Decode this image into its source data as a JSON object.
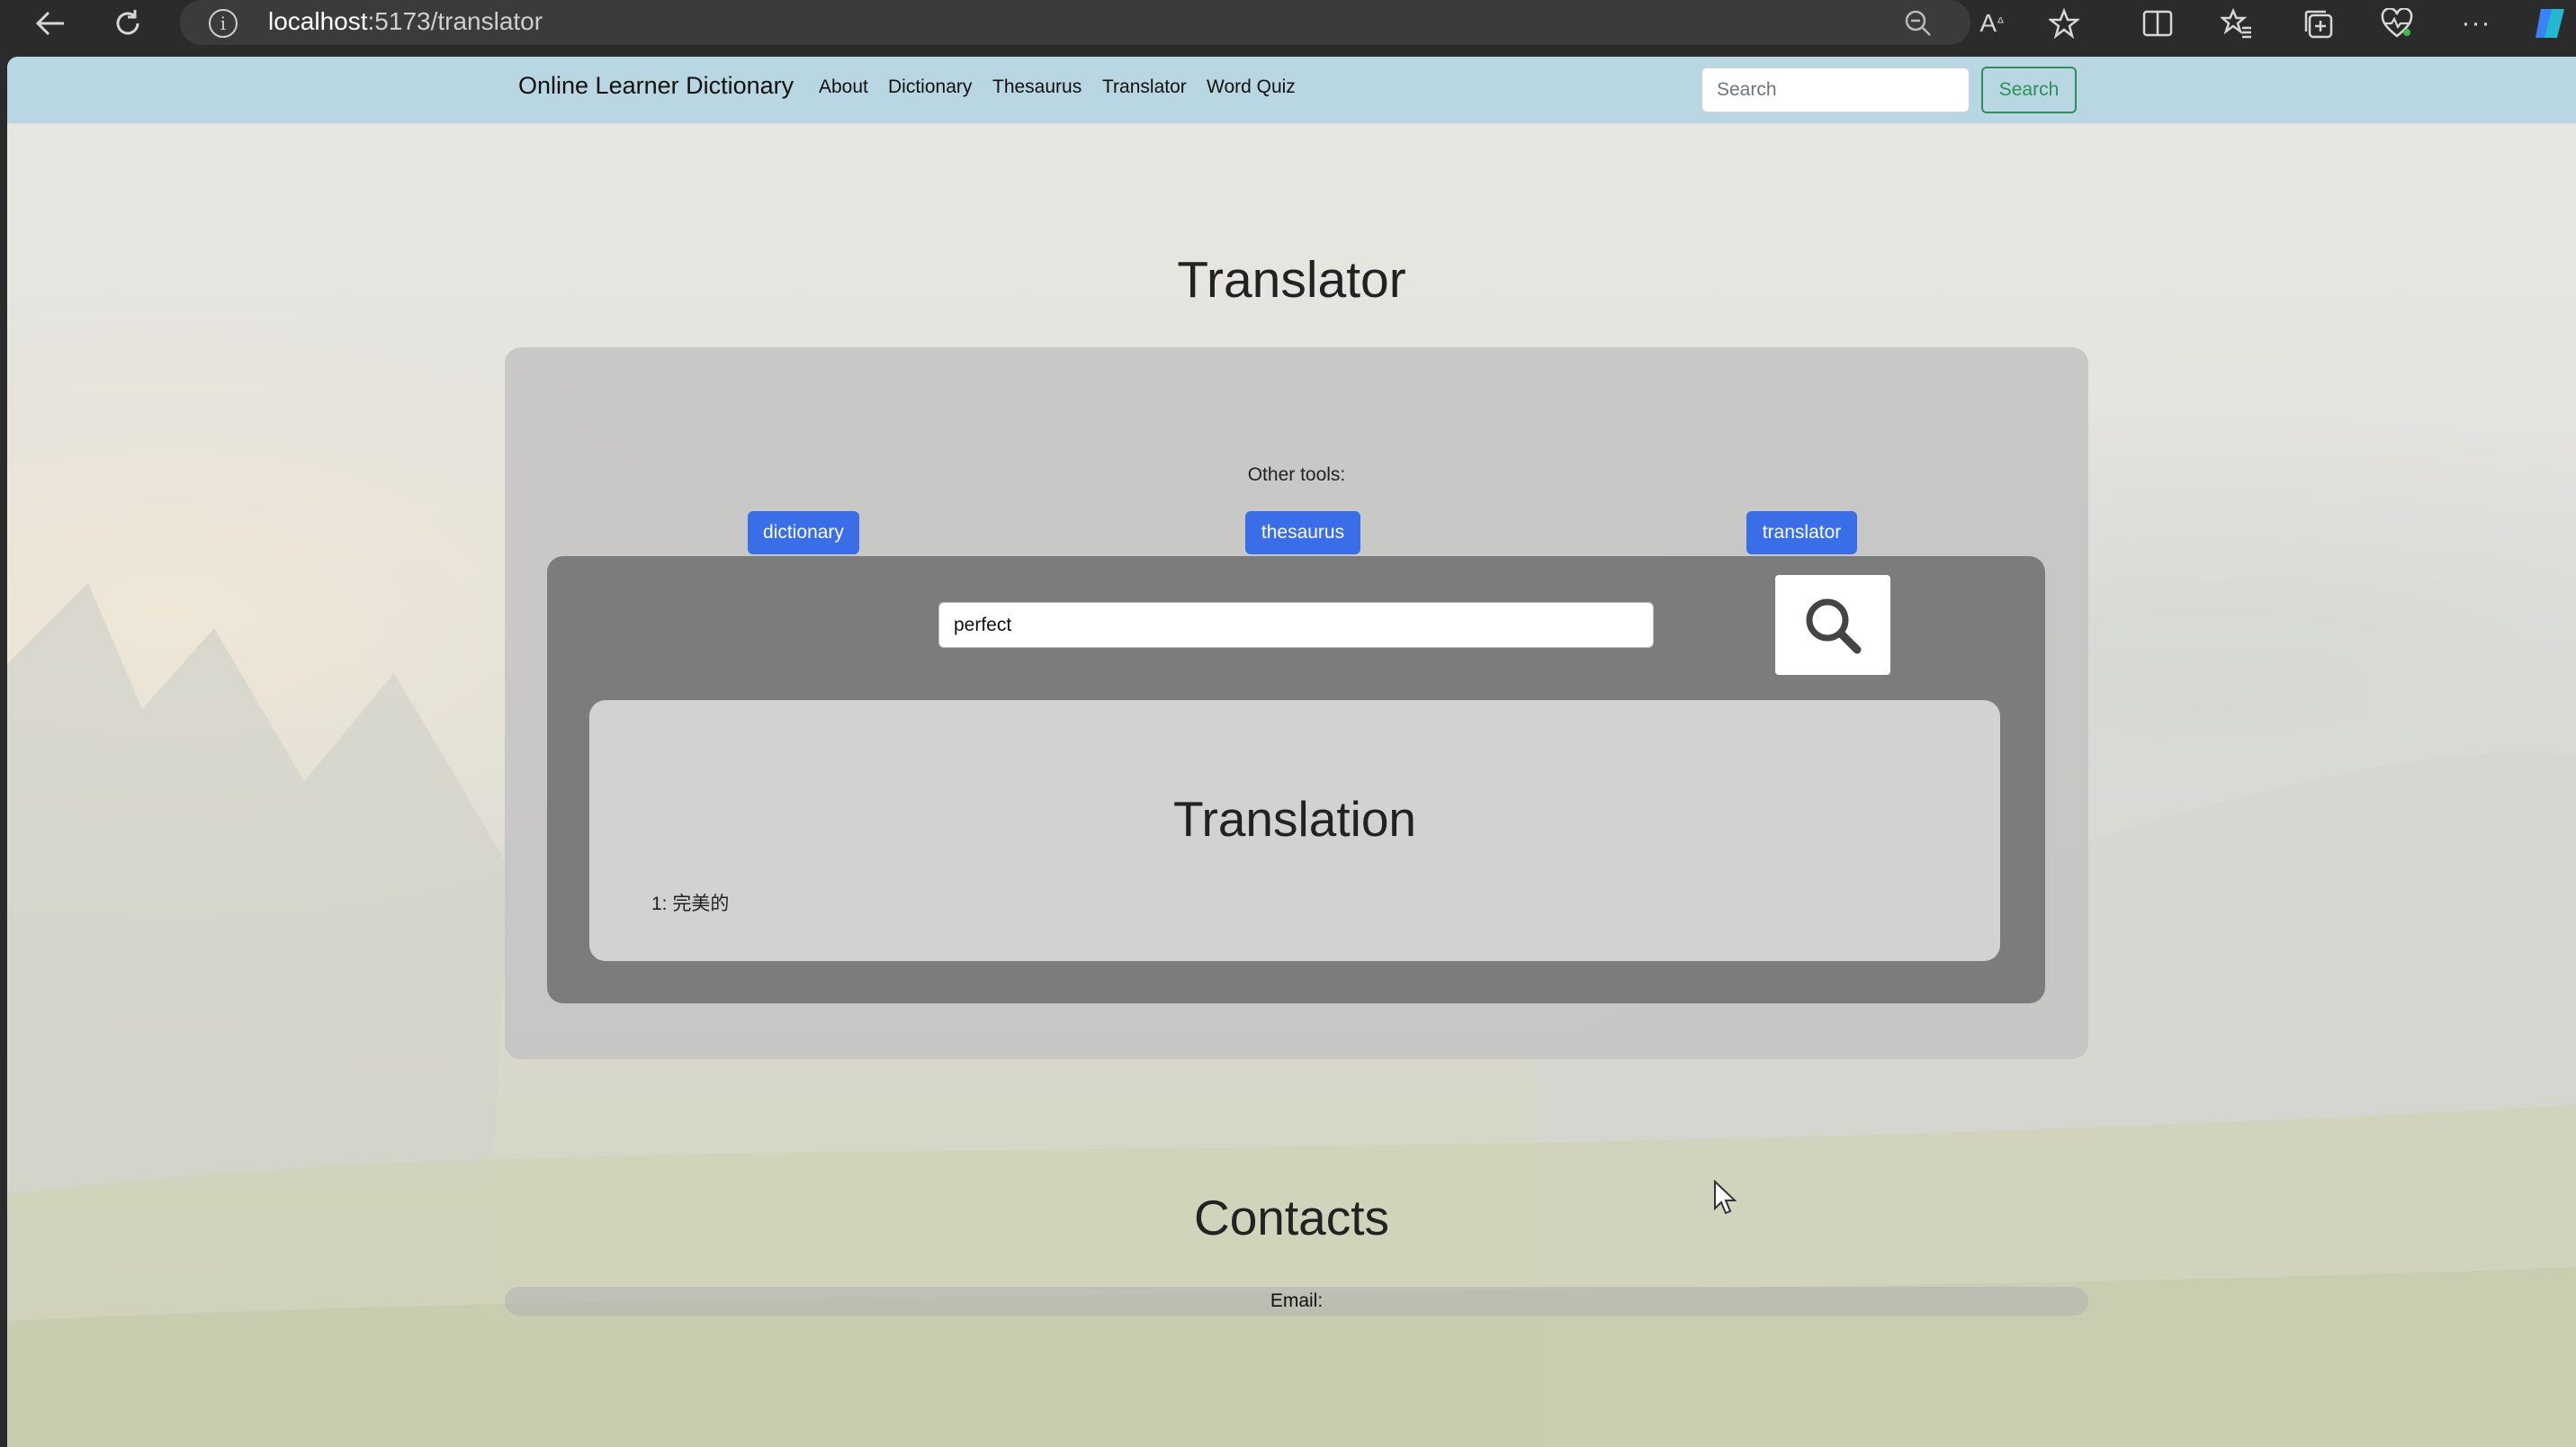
{
  "browser": {
    "url_host": "localhost",
    "url_rest": ":5173/translator"
  },
  "navbar": {
    "brand": "Online Learner Dictionary",
    "links": [
      "About",
      "Dictionary",
      "Thesaurus",
      "Translator",
      "Word Quiz"
    ],
    "search_placeholder": "Search",
    "search_button": "Search"
  },
  "page": {
    "title": "Translator",
    "other_tools_label": "Other tools:",
    "tools": [
      "dictionary",
      "thesaurus",
      "translator"
    ],
    "query_value": "perfect",
    "result_heading": "Translation",
    "results": [
      "1: 完美的"
    ],
    "contacts_heading": "Contacts",
    "email_label": "Email:"
  },
  "colors": {
    "navbar": "#b8d7e3",
    "tool_button": "#3a6ee8",
    "nav_search_button": "#2f8f56"
  }
}
